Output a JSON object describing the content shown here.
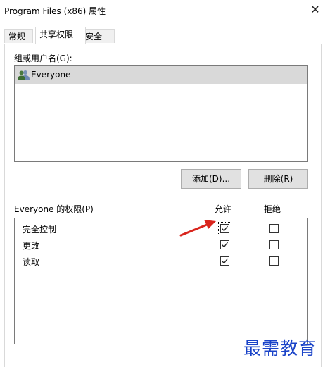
{
  "window": {
    "title": "Program Files (x86) 属性"
  },
  "tabs": [
    {
      "label": "常规"
    },
    {
      "label": "共享权限"
    },
    {
      "label": "安全"
    }
  ],
  "groups": {
    "label": "组或用户名(G):",
    "items": [
      {
        "name": "Everyone"
      }
    ]
  },
  "buttons": {
    "add": "添加(D)...",
    "remove": "删除(R)"
  },
  "permissions": {
    "label": "Everyone 的权限(P)",
    "allow_header": "允许",
    "deny_header": "拒绝",
    "rows": [
      {
        "name": "完全控制",
        "allow": true,
        "deny": false
      },
      {
        "name": "更改",
        "allow": true,
        "deny": false
      },
      {
        "name": "读取",
        "allow": true,
        "deny": false
      }
    ]
  },
  "watermark": "最需教育",
  "colors": {
    "arrow": "#d9251d",
    "watermark": "#1a43c8"
  }
}
